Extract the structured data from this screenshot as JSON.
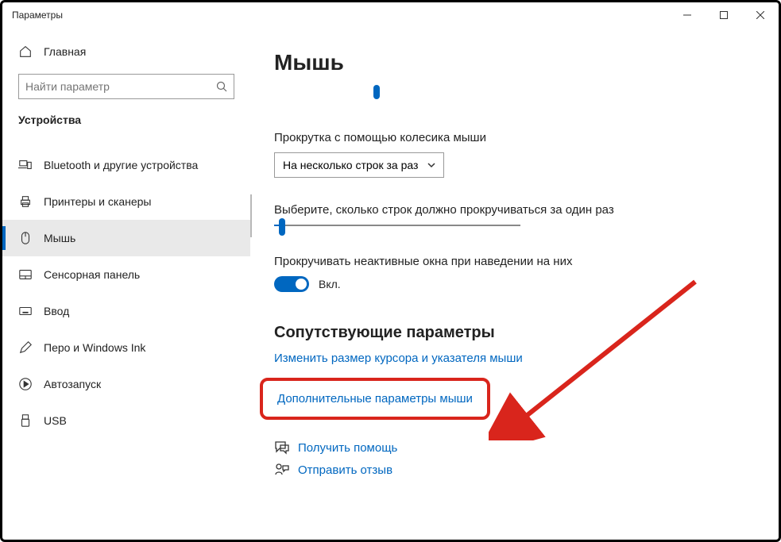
{
  "window": {
    "title": "Параметры"
  },
  "sidebar": {
    "home_label": "Главная",
    "search_placeholder": "Найти параметр",
    "category": "Устройства",
    "items": [
      {
        "label": "Bluetooth и другие устройства"
      },
      {
        "label": "Принтеры и сканеры"
      },
      {
        "label": "Мышь"
      },
      {
        "label": "Сенсорная панель"
      },
      {
        "label": "Ввод"
      },
      {
        "label": "Перо и Windows Ink"
      },
      {
        "label": "Автозапуск"
      },
      {
        "label": "USB"
      }
    ]
  },
  "main": {
    "title": "Мышь",
    "scroll_label": "Прокрутка с помощью колесика мыши",
    "scroll_select_value": "На несколько строк за раз",
    "lines_label": "Выберите, сколько строк должно прокручиваться за один раз",
    "inactive_label": "Прокручивать неактивные окна при наведении на них",
    "toggle_state": "Вкл.",
    "related_heading": "Сопутствующие параметры",
    "link_cursor": "Изменить размер курсора и указателя мыши",
    "link_advanced": "Дополнительные параметры мыши",
    "help_link": "Получить помощь",
    "feedback_link": "Отправить отзыв"
  }
}
